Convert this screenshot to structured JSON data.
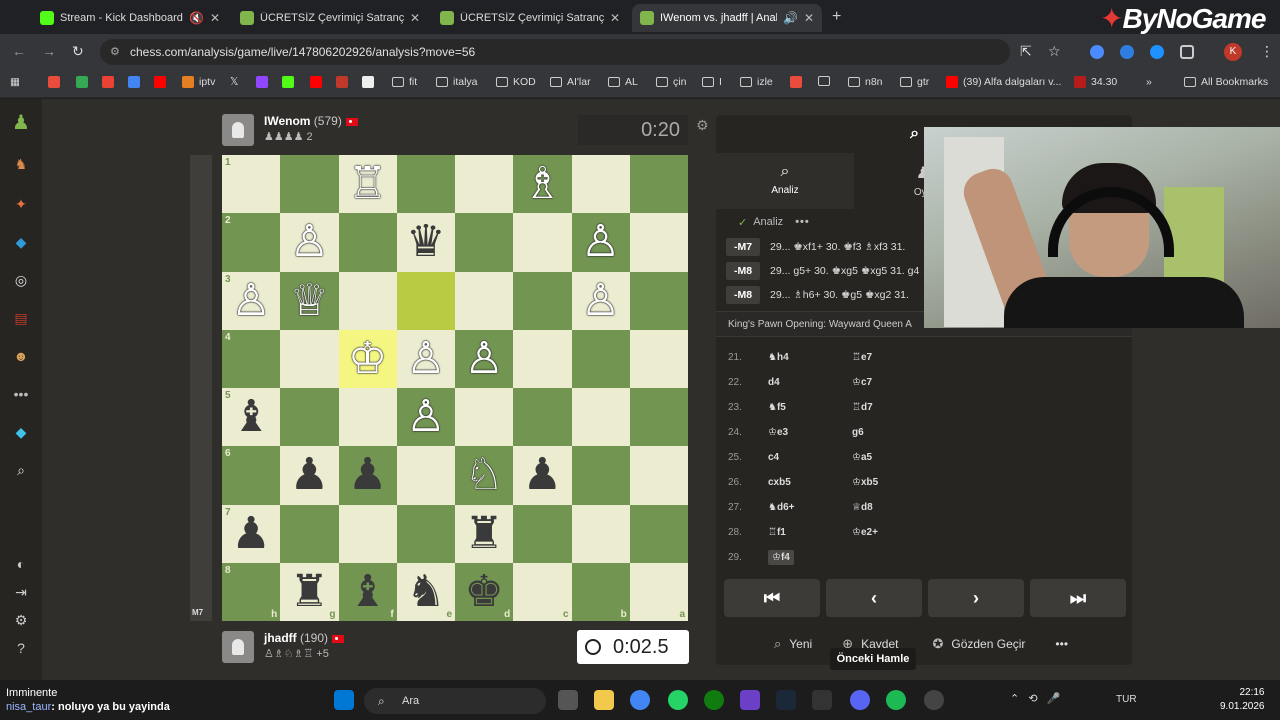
{
  "browser": {
    "tabs": [
      {
        "title": "Stream - Kick Dashboard",
        "color": "#53fc18",
        "active": false
      },
      {
        "title": "ÜCRETSİZ Çevrimiçi Satranç Oy...",
        "color": "#81b64c",
        "active": false
      },
      {
        "title": "ÜCRETSİZ Çevrimiçi Satranç Oy...",
        "color": "#81b64c",
        "active": false
      },
      {
        "title": "IWenom vs. jhadff | Analysis",
        "color": "#81b64c",
        "active": true
      }
    ],
    "url": "chess.com/analysis/game/live/147806202926/analysis?move=56",
    "profile_initial": "K",
    "bookmarks": [
      "iptv",
      "fit",
      "italya",
      "KOD",
      "AI'lar",
      "AL",
      "çin",
      "izle",
      "n8n",
      "gtr",
      "(39) Alfa dalgaları v...",
      "34.30",
      "All Bookmarks"
    ],
    "overlay_logo": "ByNoGame"
  },
  "players": {
    "top": {
      "name": "IWenom",
      "rating": "(579)",
      "clock": "0:20",
      "captured": "♟♟♟♟ 2"
    },
    "bottom": {
      "name": "jhadff",
      "rating": "(190)",
      "clock": "0:02.5",
      "captured": "♙♗♘♗♖ +5"
    }
  },
  "eval_label": "M7",
  "board": {
    "ranks": [
      "1",
      "2",
      "3",
      "4",
      "5",
      "6",
      "7",
      "8"
    ],
    "files": [
      "h",
      "g",
      "f",
      "e",
      "d",
      "c",
      "b",
      "a"
    ],
    "rows": [
      [
        "",
        "",
        "wR",
        "",
        "",
        "wB",
        "",
        ""
      ],
      [
        "",
        "wP",
        "",
        "bQ",
        "",
        "",
        "wP",
        ""
      ],
      [
        "wP",
        "wQ",
        "",
        "",
        "",
        "",
        "wP",
        ""
      ],
      [
        "",
        "",
        "wK",
        "wP",
        "wP",
        "",
        "",
        ""
      ],
      [
        "bB",
        "",
        "",
        "wP",
        "",
        "",
        "",
        ""
      ],
      [
        "",
        "bP",
        "bP",
        "",
        "wN",
        "bP",
        "",
        ""
      ],
      [
        "bP",
        "",
        "",
        "",
        "bR",
        "",
        "",
        ""
      ],
      [
        "",
        "bR",
        "bB",
        "bN",
        "bK",
        "",
        "",
        ""
      ]
    ]
  },
  "panel": {
    "title": "A",
    "tab_analysis": "Analiz",
    "tab_other": "Oyu",
    "analiz_label": "Analiz",
    "lines": [
      {
        "eval": "-M7",
        "text": "29... ♚xf1+ 30. ♚f3 ♗xf3 31."
      },
      {
        "eval": "-M8",
        "text": "29... g5+ 30. ♚xg5 ♚xg5 31. g4"
      },
      {
        "eval": "-M8",
        "text": "29... ♗h6+ 30. ♚g5 ♚xg2 31."
      }
    ],
    "opening": "King's Pawn Opening: Wayward Queen A",
    "moves": [
      {
        "n": "21.",
        "w": "♞h4",
        "b": "♖e7"
      },
      {
        "n": "22.",
        "w": "d4",
        "b": "♔c7"
      },
      {
        "n": "23.",
        "w": "♞f5",
        "b": "♖d7"
      },
      {
        "n": "24.",
        "w": "♔e3",
        "b": "g6"
      },
      {
        "n": "25.",
        "w": "c4",
        "b": "♔a5"
      },
      {
        "n": "26.",
        "w": "cxb5",
        "b": "♔xb5"
      },
      {
        "n": "27.",
        "w": "♞d6+",
        "b": "♕d8"
      },
      {
        "n": "28.",
        "w": "♖f1",
        "b": "♔e2+"
      },
      {
        "n": "29.",
        "w": "♔f4",
        "b": ""
      }
    ],
    "controls": [
      "⏮",
      "‹",
      "›",
      "⏭"
    ],
    "actions": {
      "new": "Yeni",
      "save": "Kaydet",
      "review": "Gözden Geçir"
    },
    "tooltip": "Önceki Hamle"
  },
  "taskbar": {
    "chat_title": "Imminente",
    "chat_user": "nisa_taur",
    "chat_msg": ": noluyo ya bu yayinda",
    "search": "Ara",
    "lang": "TUR",
    "time": "22:16",
    "date": "9.01.2026"
  }
}
